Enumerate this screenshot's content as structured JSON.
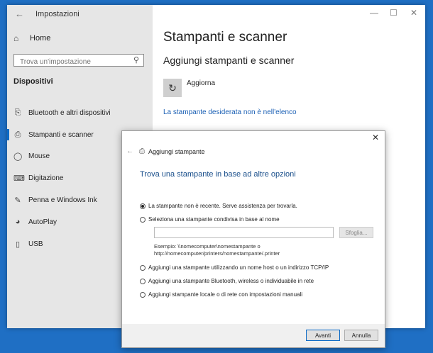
{
  "window": {
    "title": "Impostazioni"
  },
  "sidebar": {
    "home_label": "Home",
    "search_placeholder": "Trova un'impostazione",
    "section_label": "Dispositivi",
    "items": [
      {
        "label": "Bluetooth e altri dispositivi",
        "icon": "bluetooth-icon"
      },
      {
        "label": "Stampanti e scanner",
        "icon": "printer-icon",
        "active": true
      },
      {
        "label": "Mouse",
        "icon": "mouse-icon"
      },
      {
        "label": "Digitazione",
        "icon": "keyboard-icon"
      },
      {
        "label": "Penna e Windows Ink",
        "icon": "pen-icon"
      },
      {
        "label": "AutoPlay",
        "icon": "autoplay-icon"
      },
      {
        "label": "USB",
        "icon": "usb-icon"
      }
    ]
  },
  "main": {
    "page_title": "Stampanti e scanner",
    "section_title": "Aggiungi stampanti e scanner",
    "refresh_label": "Aggiorna",
    "missing_printer_link": "La stampante desiderata non è nell'elenco"
  },
  "dialog": {
    "title": "Aggiungi stampante",
    "heading": "Trova una stampante in base ad altre opzioni",
    "options": [
      "La stampante non è recente. Serve assistenza per trovarla.",
      "Seleziona una stampante condivisa in base al nome",
      "Aggiungi una stampante utilizzando un nome host o un indirizzo TCP/IP",
      "Aggiungi una stampante Bluetooth, wireless o individuabile in rete",
      "Aggiungi stampante locale o di rete con impostazioni manuali"
    ],
    "selected_option": 0,
    "browse_label": "Sfoglia...",
    "example_line1": "Esempio: \\\\nomecomputer\\nomestampante o",
    "example_line2": "http://nomecomputer/printers/nomestampante/.printer",
    "next_label": "Avanti",
    "cancel_label": "Annulla"
  },
  "colors": {
    "desktop": "#1f6fc4",
    "accent": "#0b6ac6",
    "link": "#1a5fb4"
  }
}
